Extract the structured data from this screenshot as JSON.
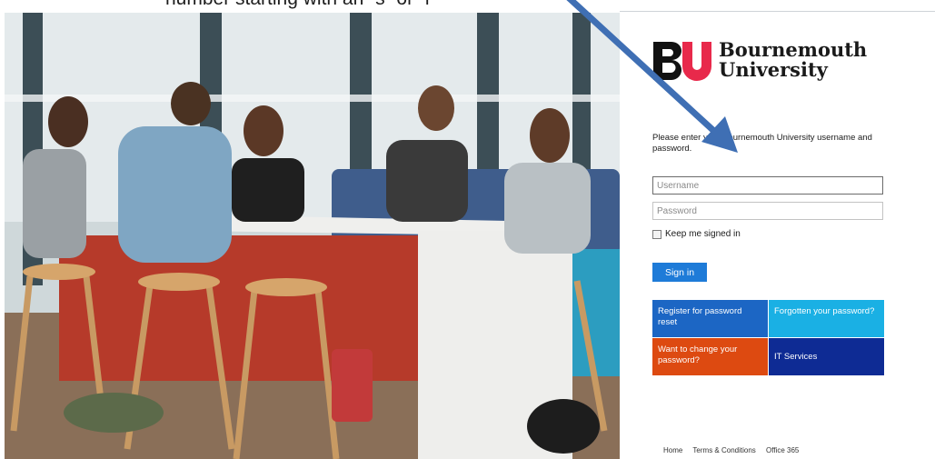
{
  "caption": {
    "text": "number starting with an “s” or “i”"
  },
  "brand": {
    "line1": "Bournemouth",
    "line2": "University",
    "logo_letters": "BU",
    "mark_colors": [
      "#111111",
      "#e8294b"
    ]
  },
  "login": {
    "prompt": "Please enter your Bournemouth University username and password.",
    "username_placeholder": "Username",
    "password_placeholder": "Password",
    "keep_signed_in": "Keep me signed in",
    "signin_label": "Sign in"
  },
  "tiles": [
    {
      "label": "Register for password reset",
      "color": "#1c66c4"
    },
    {
      "label": "Forgotten your password?",
      "color": "#1ab0e4"
    },
    {
      "label": "Want to change your password?",
      "color": "#dd4a11"
    },
    {
      "label": "IT Services",
      "color": "#0e2b94"
    }
  ],
  "footer": {
    "links": [
      "Home",
      "Terms & Conditions",
      "Office 365"
    ]
  },
  "annotation": {
    "arrow_color": "#3f6fb4"
  }
}
